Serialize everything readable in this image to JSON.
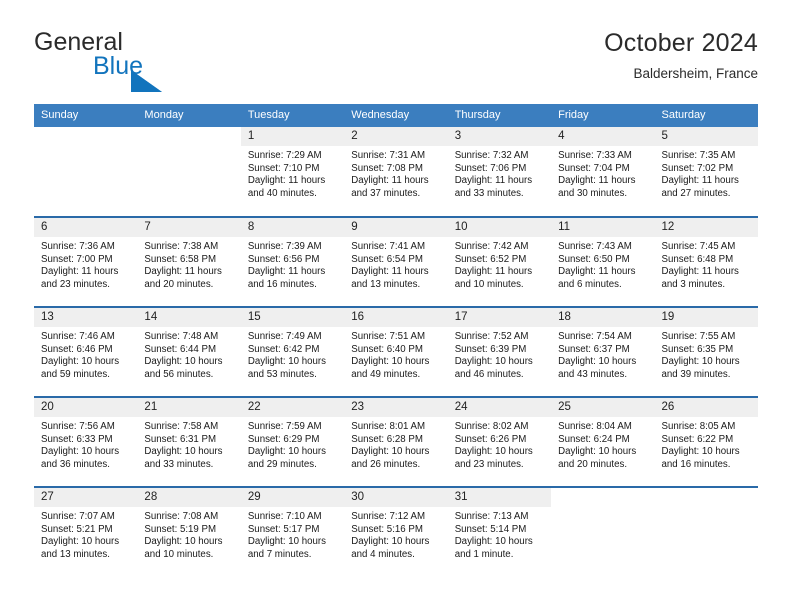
{
  "brand": {
    "name_part1": "General",
    "name_part2": "Blue",
    "triangle_color": "#1274bd"
  },
  "header": {
    "title": "October 2024",
    "location": "Baldersheim, France",
    "header_bg": "#3b7ebf",
    "row_divider_color": "#2a6aa8",
    "daynum_bg": "#efefef"
  },
  "weekdays": [
    "Sunday",
    "Monday",
    "Tuesday",
    "Wednesday",
    "Thursday",
    "Friday",
    "Saturday"
  ],
  "weeks": [
    [
      {
        "day": "",
        "lines": []
      },
      {
        "day": "",
        "lines": []
      },
      {
        "day": "1",
        "lines": [
          "Sunrise: 7:29 AM",
          "Sunset: 7:10 PM",
          "Daylight: 11 hours",
          "and 40 minutes."
        ]
      },
      {
        "day": "2",
        "lines": [
          "Sunrise: 7:31 AM",
          "Sunset: 7:08 PM",
          "Daylight: 11 hours",
          "and 37 minutes."
        ]
      },
      {
        "day": "3",
        "lines": [
          "Sunrise: 7:32 AM",
          "Sunset: 7:06 PM",
          "Daylight: 11 hours",
          "and 33 minutes."
        ]
      },
      {
        "day": "4",
        "lines": [
          "Sunrise: 7:33 AM",
          "Sunset: 7:04 PM",
          "Daylight: 11 hours",
          "and 30 minutes."
        ]
      },
      {
        "day": "5",
        "lines": [
          "Sunrise: 7:35 AM",
          "Sunset: 7:02 PM",
          "Daylight: 11 hours",
          "and 27 minutes."
        ]
      }
    ],
    [
      {
        "day": "6",
        "lines": [
          "Sunrise: 7:36 AM",
          "Sunset: 7:00 PM",
          "Daylight: 11 hours",
          "and 23 minutes."
        ]
      },
      {
        "day": "7",
        "lines": [
          "Sunrise: 7:38 AM",
          "Sunset: 6:58 PM",
          "Daylight: 11 hours",
          "and 20 minutes."
        ]
      },
      {
        "day": "8",
        "lines": [
          "Sunrise: 7:39 AM",
          "Sunset: 6:56 PM",
          "Daylight: 11 hours",
          "and 16 minutes."
        ]
      },
      {
        "day": "9",
        "lines": [
          "Sunrise: 7:41 AM",
          "Sunset: 6:54 PM",
          "Daylight: 11 hours",
          "and 13 minutes."
        ]
      },
      {
        "day": "10",
        "lines": [
          "Sunrise: 7:42 AM",
          "Sunset: 6:52 PM",
          "Daylight: 11 hours",
          "and 10 minutes."
        ]
      },
      {
        "day": "11",
        "lines": [
          "Sunrise: 7:43 AM",
          "Sunset: 6:50 PM",
          "Daylight: 11 hours",
          "and 6 minutes."
        ]
      },
      {
        "day": "12",
        "lines": [
          "Sunrise: 7:45 AM",
          "Sunset: 6:48 PM",
          "Daylight: 11 hours",
          "and 3 minutes."
        ]
      }
    ],
    [
      {
        "day": "13",
        "lines": [
          "Sunrise: 7:46 AM",
          "Sunset: 6:46 PM",
          "Daylight: 10 hours",
          "and 59 minutes."
        ]
      },
      {
        "day": "14",
        "lines": [
          "Sunrise: 7:48 AM",
          "Sunset: 6:44 PM",
          "Daylight: 10 hours",
          "and 56 minutes."
        ]
      },
      {
        "day": "15",
        "lines": [
          "Sunrise: 7:49 AM",
          "Sunset: 6:42 PM",
          "Daylight: 10 hours",
          "and 53 minutes."
        ]
      },
      {
        "day": "16",
        "lines": [
          "Sunrise: 7:51 AM",
          "Sunset: 6:40 PM",
          "Daylight: 10 hours",
          "and 49 minutes."
        ]
      },
      {
        "day": "17",
        "lines": [
          "Sunrise: 7:52 AM",
          "Sunset: 6:39 PM",
          "Daylight: 10 hours",
          "and 46 minutes."
        ]
      },
      {
        "day": "18",
        "lines": [
          "Sunrise: 7:54 AM",
          "Sunset: 6:37 PM",
          "Daylight: 10 hours",
          "and 43 minutes."
        ]
      },
      {
        "day": "19",
        "lines": [
          "Sunrise: 7:55 AM",
          "Sunset: 6:35 PM",
          "Daylight: 10 hours",
          "and 39 minutes."
        ]
      }
    ],
    [
      {
        "day": "20",
        "lines": [
          "Sunrise: 7:56 AM",
          "Sunset: 6:33 PM",
          "Daylight: 10 hours",
          "and 36 minutes."
        ]
      },
      {
        "day": "21",
        "lines": [
          "Sunrise: 7:58 AM",
          "Sunset: 6:31 PM",
          "Daylight: 10 hours",
          "and 33 minutes."
        ]
      },
      {
        "day": "22",
        "lines": [
          "Sunrise: 7:59 AM",
          "Sunset: 6:29 PM",
          "Daylight: 10 hours",
          "and 29 minutes."
        ]
      },
      {
        "day": "23",
        "lines": [
          "Sunrise: 8:01 AM",
          "Sunset: 6:28 PM",
          "Daylight: 10 hours",
          "and 26 minutes."
        ]
      },
      {
        "day": "24",
        "lines": [
          "Sunrise: 8:02 AM",
          "Sunset: 6:26 PM",
          "Daylight: 10 hours",
          "and 23 minutes."
        ]
      },
      {
        "day": "25",
        "lines": [
          "Sunrise: 8:04 AM",
          "Sunset: 6:24 PM",
          "Daylight: 10 hours",
          "and 20 minutes."
        ]
      },
      {
        "day": "26",
        "lines": [
          "Sunrise: 8:05 AM",
          "Sunset: 6:22 PM",
          "Daylight: 10 hours",
          "and 16 minutes."
        ]
      }
    ],
    [
      {
        "day": "27",
        "lines": [
          "Sunrise: 7:07 AM",
          "Sunset: 5:21 PM",
          "Daylight: 10 hours",
          "and 13 minutes."
        ]
      },
      {
        "day": "28",
        "lines": [
          "Sunrise: 7:08 AM",
          "Sunset: 5:19 PM",
          "Daylight: 10 hours",
          "and 10 minutes."
        ]
      },
      {
        "day": "29",
        "lines": [
          "Sunrise: 7:10 AM",
          "Sunset: 5:17 PM",
          "Daylight: 10 hours",
          "and 7 minutes."
        ]
      },
      {
        "day": "30",
        "lines": [
          "Sunrise: 7:12 AM",
          "Sunset: 5:16 PM",
          "Daylight: 10 hours",
          "and 4 minutes."
        ]
      },
      {
        "day": "31",
        "lines": [
          "Sunrise: 7:13 AM",
          "Sunset: 5:14 PM",
          "Daylight: 10 hours",
          "and 1 minute."
        ]
      },
      {
        "day": "",
        "lines": []
      },
      {
        "day": "",
        "lines": []
      }
    ]
  ]
}
